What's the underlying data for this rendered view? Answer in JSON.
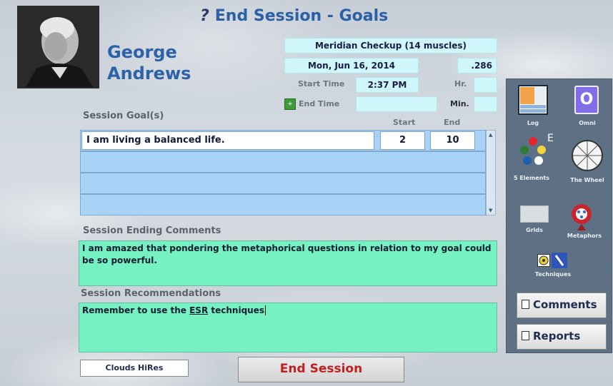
{
  "header": {
    "help_icon": "?",
    "title": "End Session - Goals"
  },
  "client": {
    "first": "George",
    "last": "Andrews"
  },
  "session": {
    "type": "Meridian Checkup (14 muscles)",
    "date": "Mon, Jun 16, 2014",
    "code": ".286",
    "start_time_label": "Start Time",
    "start_time": "2:37 PM",
    "end_time_label": "End Time",
    "end_time": "",
    "hr_label": "Hr.",
    "hr": "",
    "min_label": "Min.",
    "min": "",
    "end_time_button": "+"
  },
  "goals": {
    "title": "Session Goal(s)",
    "start_header": "Start",
    "end_header": "End",
    "rows": [
      {
        "text": "I am living a balanced life.",
        "start": "2",
        "end": "10"
      }
    ]
  },
  "comments": {
    "title": "Session Ending Comments",
    "text": "I am amazed that pondering the metaphorical questions in relation to my goal could be so powerful."
  },
  "recommendations": {
    "title": "Session Recommendations",
    "text_before": "Remember to use the ",
    "text_underlined": "ESR",
    "text_after": " techniques"
  },
  "tools": {
    "log": "Log",
    "omni": "Omni",
    "omni_glyph": "O",
    "five_elements": "5 Elements",
    "five_elements_badge": "E",
    "wheel": "The Wheel",
    "grids": "Grids",
    "metaphors": "Metaphors",
    "techniques": "Techniques"
  },
  "buttons": {
    "comments": "Comments",
    "reports": "Reports",
    "background": "Clouds HiRes",
    "end_session": "End Session"
  },
  "colors": {
    "accent": "#2d62a8",
    "end_session_text": "#c31f1f",
    "comment_fill": "#76f2c2",
    "goal_row_fill": "#a9d2f7",
    "info_fill": "#cff7fb",
    "panel": "#5e7184"
  }
}
